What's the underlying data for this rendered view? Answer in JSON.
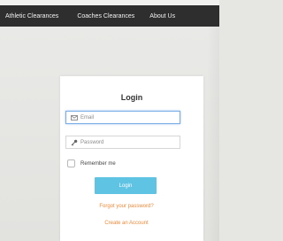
{
  "nav": {
    "items": [
      {
        "label": "Athletic Clearances"
      },
      {
        "label": "Coaches Clearances"
      },
      {
        "label": "About Us"
      }
    ]
  },
  "login": {
    "title": "Login",
    "email_placeholder": "Email",
    "password_placeholder": "Password",
    "remember_label": "Remember me",
    "remember_checked": false,
    "button_label": "Login",
    "forgot_link": "Forgot your password?",
    "create_link": "Create an Account"
  },
  "colors": {
    "nav_bg": "#2e2e2e",
    "button": "#5fc3e4",
    "link": "#f08a3a",
    "focus_border": "#7aaee6"
  },
  "icons": {
    "email_field": "envelope-icon",
    "password_field": "key-icon"
  }
}
